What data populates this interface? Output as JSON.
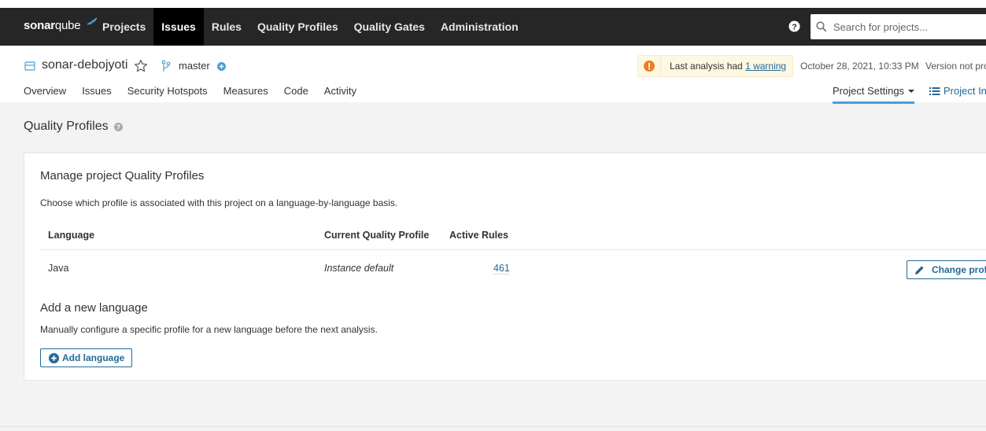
{
  "topbar": {
    "logo_bold": "sonar",
    "logo_light": "qube",
    "nav": [
      {
        "label": "Projects",
        "active": false
      },
      {
        "label": "Issues",
        "active": true
      },
      {
        "label": "Rules",
        "active": false
      },
      {
        "label": "Quality Profiles",
        "active": false
      },
      {
        "label": "Quality Gates",
        "active": false
      },
      {
        "label": "Administration",
        "active": false
      }
    ],
    "search_placeholder": "Search for projects..."
  },
  "project": {
    "name": "sonar-debojyoti",
    "branch": "master",
    "warning_prefix": "Last analysis had ",
    "warning_link": "1 warning",
    "analysis_date": "October 28, 2021, 10:33 PM",
    "version": "Version not provided"
  },
  "subnav": {
    "items": [
      "Overview",
      "Issues",
      "Security Hotspots",
      "Measures",
      "Code",
      "Activity"
    ],
    "settings": "Project Settings",
    "info": "Project Information"
  },
  "page": {
    "title": "Quality Profiles"
  },
  "card": {
    "title": "Manage project Quality Profiles",
    "description": "Choose which profile is associated with this project on a language-by-language basis.",
    "columns": [
      "Language",
      "Current Quality Profile",
      "Active Rules"
    ],
    "rows": [
      {
        "language": "Java",
        "profile": "Instance default",
        "active_rules": "461",
        "action": "Change profile"
      }
    ],
    "add_title": "Add a new language",
    "add_description": "Manually configure a specific profile for a new language before the next analysis.",
    "add_button": "Add language"
  },
  "colors": {
    "topbar": "#262626",
    "accent": "#236a97",
    "warning_bg": "#fcf8e3",
    "warning_icon": "#ed7d20",
    "tab_underline": "#4b9fd5"
  },
  "icons": [
    "help-icon",
    "search-icon",
    "project-icon",
    "star-icon",
    "branch-icon",
    "plus-circle-icon",
    "warning-icon",
    "list-icon",
    "pencil-icon"
  ]
}
